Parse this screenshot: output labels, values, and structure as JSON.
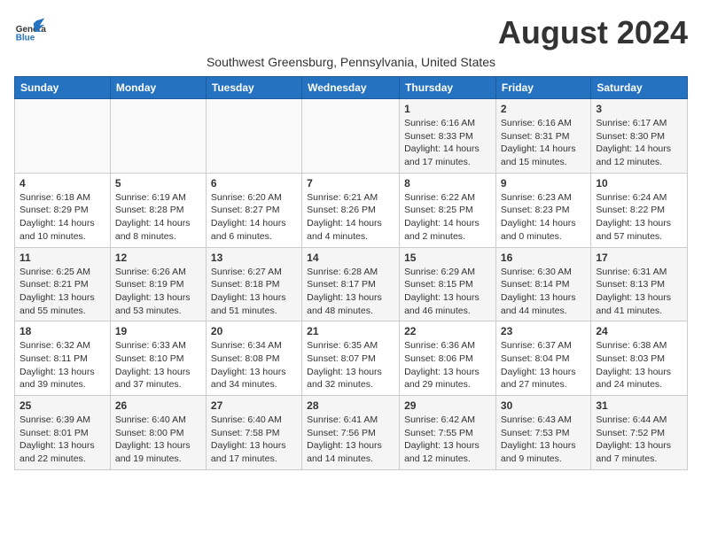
{
  "logo": {
    "line1": "General",
    "line2": "Blue"
  },
  "title": "August 2024",
  "subtitle": "Southwest Greensburg, Pennsylvania, United States",
  "headers": [
    "Sunday",
    "Monday",
    "Tuesday",
    "Wednesday",
    "Thursday",
    "Friday",
    "Saturday"
  ],
  "weeks": [
    [
      {
        "day": "",
        "info": ""
      },
      {
        "day": "",
        "info": ""
      },
      {
        "day": "",
        "info": ""
      },
      {
        "day": "",
        "info": ""
      },
      {
        "day": "1",
        "info": "Sunrise: 6:16 AM\nSunset: 8:33 PM\nDaylight: 14 hours\nand 17 minutes."
      },
      {
        "day": "2",
        "info": "Sunrise: 6:16 AM\nSunset: 8:31 PM\nDaylight: 14 hours\nand 15 minutes."
      },
      {
        "day": "3",
        "info": "Sunrise: 6:17 AM\nSunset: 8:30 PM\nDaylight: 14 hours\nand 12 minutes."
      }
    ],
    [
      {
        "day": "4",
        "info": "Sunrise: 6:18 AM\nSunset: 8:29 PM\nDaylight: 14 hours\nand 10 minutes."
      },
      {
        "day": "5",
        "info": "Sunrise: 6:19 AM\nSunset: 8:28 PM\nDaylight: 14 hours\nand 8 minutes."
      },
      {
        "day": "6",
        "info": "Sunrise: 6:20 AM\nSunset: 8:27 PM\nDaylight: 14 hours\nand 6 minutes."
      },
      {
        "day": "7",
        "info": "Sunrise: 6:21 AM\nSunset: 8:26 PM\nDaylight: 14 hours\nand 4 minutes."
      },
      {
        "day": "8",
        "info": "Sunrise: 6:22 AM\nSunset: 8:25 PM\nDaylight: 14 hours\nand 2 minutes."
      },
      {
        "day": "9",
        "info": "Sunrise: 6:23 AM\nSunset: 8:23 PM\nDaylight: 14 hours\nand 0 minutes."
      },
      {
        "day": "10",
        "info": "Sunrise: 6:24 AM\nSunset: 8:22 PM\nDaylight: 13 hours\nand 57 minutes."
      }
    ],
    [
      {
        "day": "11",
        "info": "Sunrise: 6:25 AM\nSunset: 8:21 PM\nDaylight: 13 hours\nand 55 minutes."
      },
      {
        "day": "12",
        "info": "Sunrise: 6:26 AM\nSunset: 8:19 PM\nDaylight: 13 hours\nand 53 minutes."
      },
      {
        "day": "13",
        "info": "Sunrise: 6:27 AM\nSunset: 8:18 PM\nDaylight: 13 hours\nand 51 minutes."
      },
      {
        "day": "14",
        "info": "Sunrise: 6:28 AM\nSunset: 8:17 PM\nDaylight: 13 hours\nand 48 minutes."
      },
      {
        "day": "15",
        "info": "Sunrise: 6:29 AM\nSunset: 8:15 PM\nDaylight: 13 hours\nand 46 minutes."
      },
      {
        "day": "16",
        "info": "Sunrise: 6:30 AM\nSunset: 8:14 PM\nDaylight: 13 hours\nand 44 minutes."
      },
      {
        "day": "17",
        "info": "Sunrise: 6:31 AM\nSunset: 8:13 PM\nDaylight: 13 hours\nand 41 minutes."
      }
    ],
    [
      {
        "day": "18",
        "info": "Sunrise: 6:32 AM\nSunset: 8:11 PM\nDaylight: 13 hours\nand 39 minutes."
      },
      {
        "day": "19",
        "info": "Sunrise: 6:33 AM\nSunset: 8:10 PM\nDaylight: 13 hours\nand 37 minutes."
      },
      {
        "day": "20",
        "info": "Sunrise: 6:34 AM\nSunset: 8:08 PM\nDaylight: 13 hours\nand 34 minutes."
      },
      {
        "day": "21",
        "info": "Sunrise: 6:35 AM\nSunset: 8:07 PM\nDaylight: 13 hours\nand 32 minutes."
      },
      {
        "day": "22",
        "info": "Sunrise: 6:36 AM\nSunset: 8:06 PM\nDaylight: 13 hours\nand 29 minutes."
      },
      {
        "day": "23",
        "info": "Sunrise: 6:37 AM\nSunset: 8:04 PM\nDaylight: 13 hours\nand 27 minutes."
      },
      {
        "day": "24",
        "info": "Sunrise: 6:38 AM\nSunset: 8:03 PM\nDaylight: 13 hours\nand 24 minutes."
      }
    ],
    [
      {
        "day": "25",
        "info": "Sunrise: 6:39 AM\nSunset: 8:01 PM\nDaylight: 13 hours\nand 22 minutes."
      },
      {
        "day": "26",
        "info": "Sunrise: 6:40 AM\nSunset: 8:00 PM\nDaylight: 13 hours\nand 19 minutes."
      },
      {
        "day": "27",
        "info": "Sunrise: 6:40 AM\nSunset: 7:58 PM\nDaylight: 13 hours\nand 17 minutes."
      },
      {
        "day": "28",
        "info": "Sunrise: 6:41 AM\nSunset: 7:56 PM\nDaylight: 13 hours\nand 14 minutes."
      },
      {
        "day": "29",
        "info": "Sunrise: 6:42 AM\nSunset: 7:55 PM\nDaylight: 13 hours\nand 12 minutes."
      },
      {
        "day": "30",
        "info": "Sunrise: 6:43 AM\nSunset: 7:53 PM\nDaylight: 13 hours\nand 9 minutes."
      },
      {
        "day": "31",
        "info": "Sunrise: 6:44 AM\nSunset: 7:52 PM\nDaylight: 13 hours\nand 7 minutes."
      }
    ]
  ]
}
